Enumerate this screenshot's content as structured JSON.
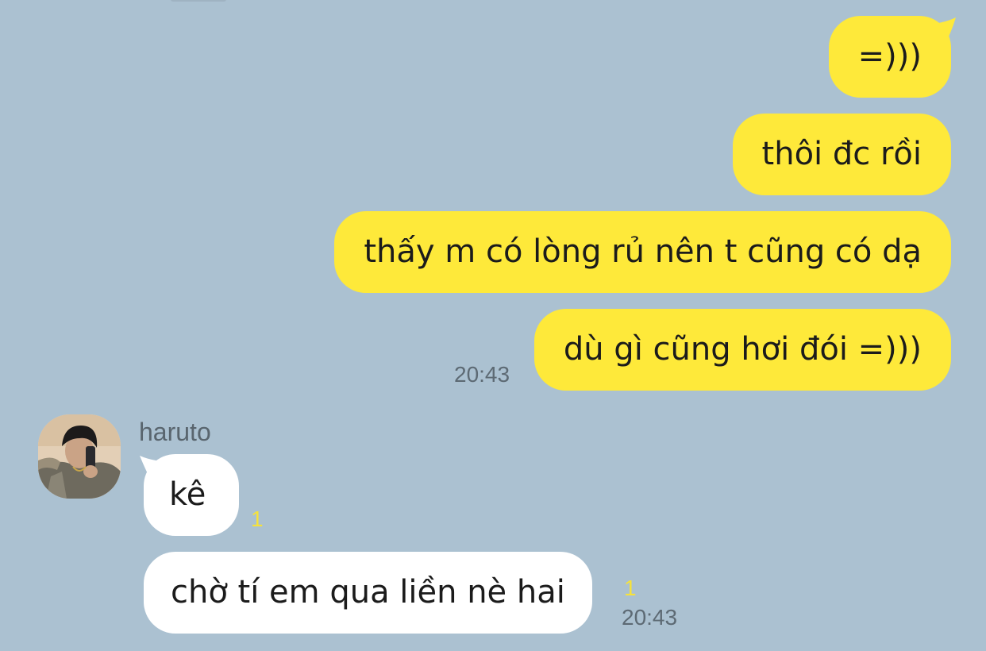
{
  "colors": {
    "background": "#abc1d1",
    "outgoing_bubble": "#fee93a",
    "incoming_bubble": "#ffffff",
    "unread_count": "#f6e23b"
  },
  "outgoing_messages": [
    {
      "text": "=)))"
    },
    {
      "text": "thôi đc rồi"
    },
    {
      "text": "thấy m có lòng rủ nên t cũng có dạ"
    },
    {
      "text": "dù gì cũng hơi đói =)))"
    }
  ],
  "outgoing_time": "20:43",
  "contact": {
    "name": "haruto",
    "avatar_icon": "profile-photo"
  },
  "incoming_messages": [
    {
      "text": "kê",
      "unread": "1"
    },
    {
      "text": "chờ tí em qua liền nè hai",
      "unread": "1"
    }
  ],
  "incoming_time": "20:43"
}
